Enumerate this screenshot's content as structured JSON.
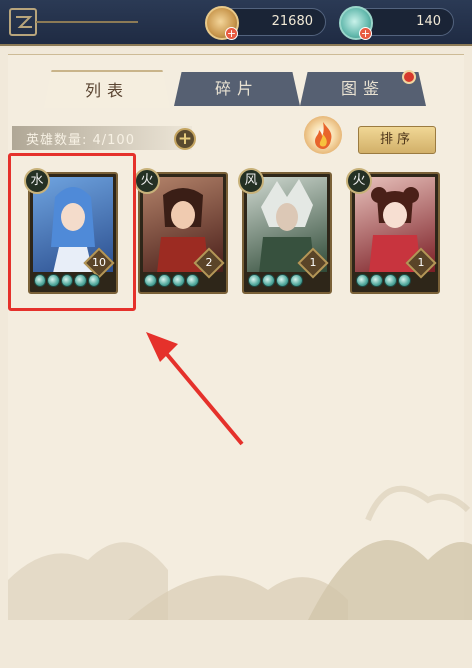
{
  "currencies": [
    {
      "name": "coins",
      "value": "21680"
    },
    {
      "name": "jade",
      "value": "140"
    }
  ],
  "tabs": [
    {
      "label": "列表",
      "active": true
    },
    {
      "label": "碎片",
      "active": false
    },
    {
      "label": "图鉴",
      "active": false
    }
  ],
  "hero_count_label": "英雄数量: 4/100",
  "sort_label": "排序",
  "heroes": [
    {
      "element": "水",
      "level": "10",
      "stars": 5,
      "theme": "#3b64a8"
    },
    {
      "element": "火",
      "level": "2",
      "stars": 4,
      "theme": "#7a2a22"
    },
    {
      "element": "风",
      "level": "1",
      "stars": 4,
      "theme": "#4b6a4b"
    },
    {
      "element": "火",
      "level": "1",
      "stars": 4,
      "theme": "#b3303a"
    }
  ],
  "colors": {
    "accent": "#e5312b",
    "topbar": "#2b3a55",
    "panel": "#f1e9da"
  }
}
